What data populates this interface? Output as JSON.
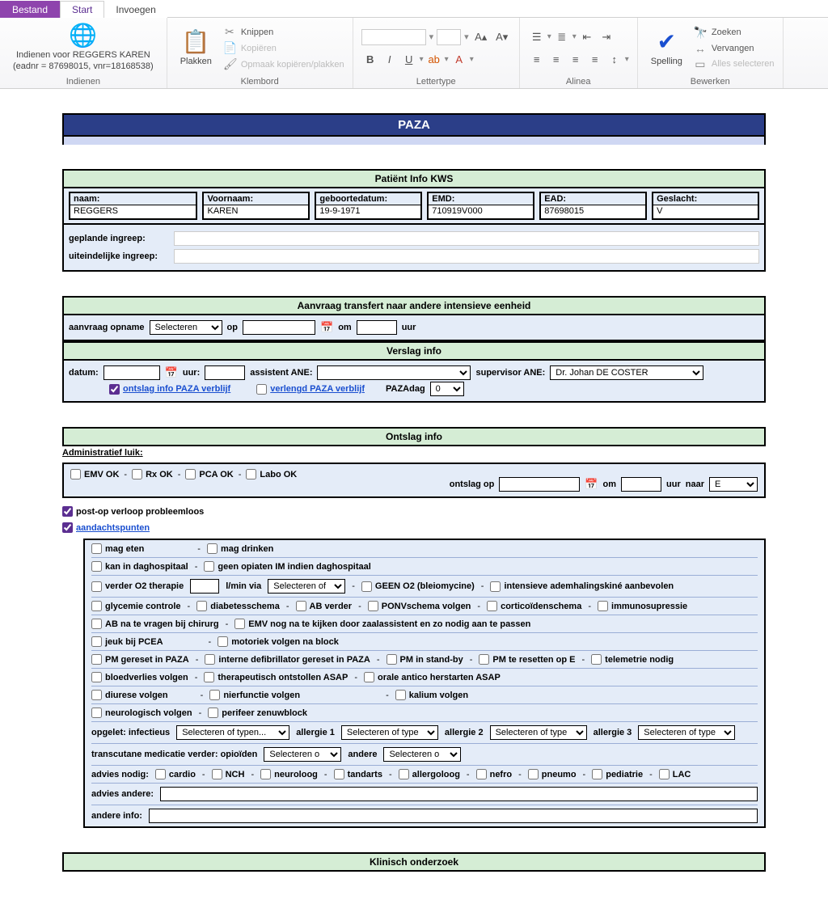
{
  "ribbon": {
    "file_tab": "Bestand",
    "start_tab": "Start",
    "insert_tab": "Invoegen",
    "submit": {
      "label_l1": "Indienen voor REGGERS KAREN",
      "label_l2": "(eadnr = 87698015, vnr=18168538)",
      "group": "Indienen"
    },
    "clipboard": {
      "paste": "Plakken",
      "cut": "Knippen",
      "copy": "Kopiëren",
      "paste_fmt": "Opmaak kopiëren/plakken",
      "group": "Klembord"
    },
    "font_group": "Lettertype",
    "para_group": "Alinea",
    "edit": {
      "spelling": "Spelling",
      "find": "Zoeken",
      "replace": "Vervangen",
      "select_all": "Alles selecteren",
      "group": "Bewerken"
    }
  },
  "hdr": {
    "title": "PAZA"
  },
  "sec": {
    "patient": "Patiënt Info KWS",
    "transfer": "Aanvraag transfert naar andere intensieve eenheid",
    "verslag": "Verslag info",
    "ontslag": "Ontslag info",
    "klinisch": "Klinisch onderzoek"
  },
  "pt": {
    "naam_l": "naam:",
    "naam_v": "REGGERS",
    "voor_l": "Voornaam:",
    "voor_v": "KAREN",
    "geb_l": "geboortedatum:",
    "geb_v": "19-9-1971",
    "emd_l": "EMD:",
    "emd_v": "710919V000",
    "ead_l": "EAD:",
    "ead_v": "87698015",
    "ges_l": "Geslacht:",
    "ges_v": "V"
  },
  "ing": {
    "planned_l": "geplande ingreep:",
    "final_l": "uiteindelijke ingreep:"
  },
  "transfer": {
    "aanvraag_l": "aanvraag opname",
    "sel": "Selecteren",
    "op": "op",
    "om": "om",
    "uur": "uur"
  },
  "verslag": {
    "datum": "datum:",
    "uur": "uur:",
    "ass": "assistent ANE:",
    "sup": "supervisor ANE:",
    "sup_v": "Dr. Johan DE COSTER",
    "ontslag_info": "ontslag info PAZA verblijf",
    "verlengd": "verlengd PAZA verblijf",
    "pazadag": "PAZAdag",
    "pazadag_v": "0"
  },
  "ont": {
    "admin": "Administratief luik:",
    "emv": "EMV OK",
    "rx": "Rx OK",
    "pca": "PCA OK",
    "labo": "Labo OK",
    "ontslag_op": "ontslag op",
    "om": "om",
    "uur": "uur",
    "naar": "naar",
    "naar_v": "E",
    "postop": "post-op verloop probleemloos",
    "aandacht": "aandachtspunten",
    "r1a": "mag eten",
    "r1b": "mag drinken",
    "r2a": "kan in daghospitaal",
    "r2b": "geen opiaten IM indien daghospitaal",
    "r3a": "verder O2 therapie",
    "r3u": "l/min via",
    "r3sel": "Selecteren of",
    "r3b": "GEEN O2 (bleiomycine)",
    "r3c": "intensieve ademhalingskiné aanbevolen",
    "r4a": "glycemie controle",
    "r4b": "diabetesschema",
    "r4c": "AB verder",
    "r4d": "PONVschema volgen",
    "r4e": "corticoïdenschema",
    "r4f": "immunosupressie",
    "r5a": "AB na te vragen bij chirurg",
    "r5b": "EMV nog na te kijken door zaalassistent en zo nodig aan te passen",
    "r6a": "jeuk bij PCEA",
    "r6b": "motoriek volgen na block",
    "r7a": "PM gereset in PAZA",
    "r7b": "interne defibrillator gereset in PAZA",
    "r7c": "PM in stand-by",
    "r7d": "PM te resetten op E",
    "r7e": "telemetrie nodig",
    "r8a": "bloedverlies volgen",
    "r8b": "therapeutisch ontstollen ASAP",
    "r8c": "orale antico herstarten ASAP",
    "r9a": "diurese volgen",
    "r9b": "nierfunctie volgen",
    "r9c": "kalium volgen",
    "r10a": "neurologisch volgen",
    "r10b": "perifeer zenuwblock",
    "r11_l": "opgelet:  infectieus",
    "r11_sel": "Selecteren of typen...",
    "r11_a1": "allergie 1",
    "r11_a2": "allergie 2",
    "r11_a3": "allergie 3",
    "r11_selshort": "Selecteren of type",
    "r12_l": "transcutane medicatie verder:  opioïden",
    "r12_sel": "Selecteren o",
    "r12_andere": "andere",
    "r13_l": "advies nodig:",
    "r13a": "cardio",
    "r13b": "NCH",
    "r13c": "neuroloog",
    "r13d": "tandarts",
    "r13e": "allergoloog",
    "r13f": "nefro",
    "r13g": "pneumo",
    "r13h": "pediatrie",
    "r13i": "LAC",
    "r14_l": "advies andere:",
    "r15_l": "andere info:"
  }
}
